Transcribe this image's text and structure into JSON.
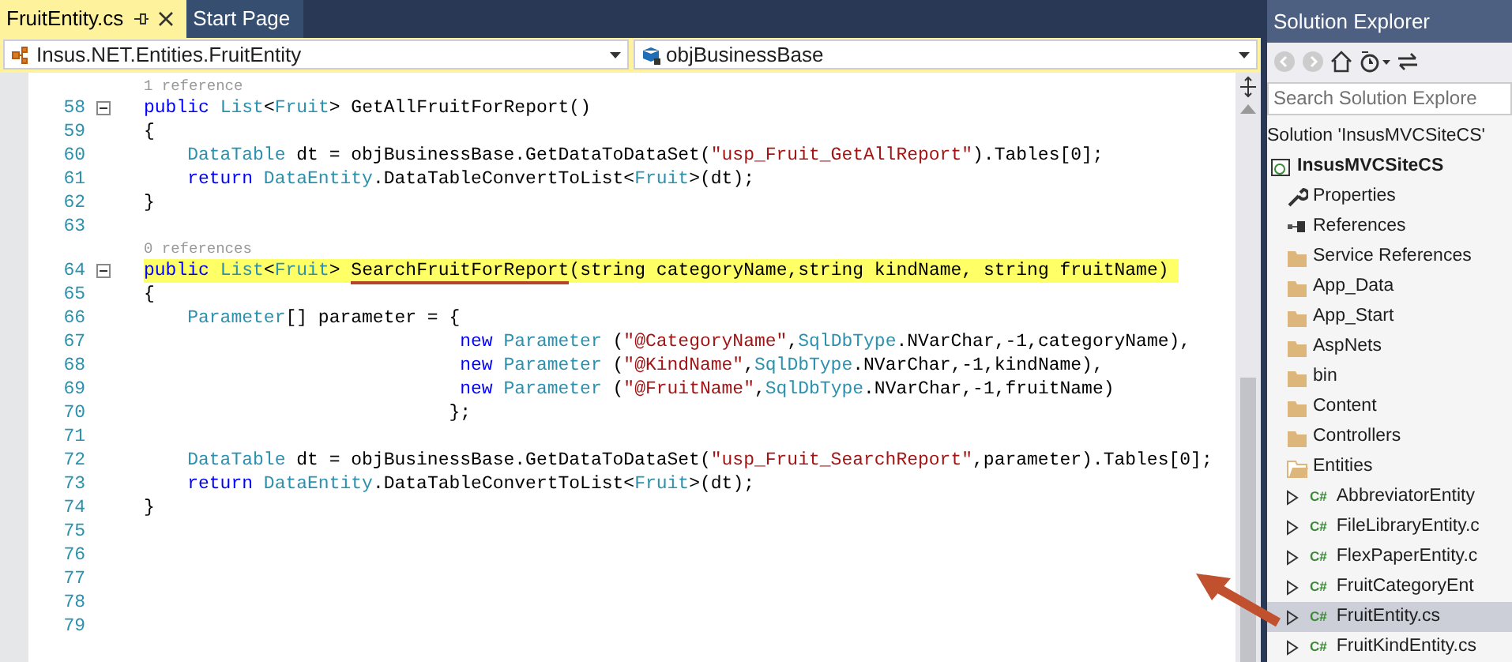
{
  "tabs": [
    {
      "label": "FruitEntity.cs",
      "selected": true,
      "pinnable": true
    },
    {
      "label": "Start Page",
      "selected": false,
      "pinnable": false
    }
  ],
  "navigation": {
    "type_dropdown": "Insus.NET.Entities.FruitEntity",
    "member_dropdown": "objBusinessBase"
  },
  "editor": {
    "lines": [
      {
        "kind": "lens",
        "text": "1 reference"
      },
      {
        "kind": "code",
        "number": "58",
        "fold": true,
        "highlighted": false,
        "tokens": [
          {
            "kind": "keyword",
            "text": "public"
          },
          {
            "kind": "type",
            "text": " List"
          },
          {
            "kind": "plain",
            "text": "<"
          },
          {
            "kind": "type",
            "text": "Fruit"
          },
          {
            "kind": "plain",
            "text": "> GetAllFruitForReport()"
          }
        ]
      },
      {
        "kind": "code",
        "number": "59",
        "fold": false,
        "highlighted": false,
        "tokens": [
          {
            "kind": "plain",
            "text": "{"
          }
        ]
      },
      {
        "kind": "code",
        "number": "60",
        "fold": false,
        "highlighted": false,
        "tokens": [
          {
            "kind": "type",
            "text": "    DataTable"
          },
          {
            "kind": "plain",
            "text": " dt = objBusinessBase.GetDataToDataSet("
          },
          {
            "kind": "string",
            "text": "\"usp_Fruit_GetAllReport\""
          },
          {
            "kind": "plain",
            "text": ").Tables[0];"
          }
        ]
      },
      {
        "kind": "code",
        "number": "61",
        "fold": false,
        "highlighted": false,
        "tokens": [
          {
            "kind": "keyword",
            "text": "    return"
          },
          {
            "kind": "type",
            "text": " DataEntity"
          },
          {
            "kind": "plain",
            "text": ".DataTableConvertToList<"
          },
          {
            "kind": "type",
            "text": "Fruit"
          },
          {
            "kind": "plain",
            "text": ">(dt);"
          }
        ]
      },
      {
        "kind": "code",
        "number": "62",
        "fold": false,
        "highlighted": false,
        "tokens": [
          {
            "kind": "plain",
            "text": "}"
          }
        ]
      },
      {
        "kind": "blank",
        "number": "63"
      },
      {
        "kind": "lens",
        "text": "0 references"
      },
      {
        "kind": "code",
        "number": "64",
        "fold": true,
        "highlighted": true,
        "tokens": [
          {
            "kind": "keyword",
            "text": "public"
          },
          {
            "kind": "type",
            "text": " List"
          },
          {
            "kind": "plain",
            "text": "<"
          },
          {
            "kind": "type",
            "text": "Fruit"
          },
          {
            "kind": "plain",
            "text": "> "
          },
          {
            "kind": "underlined",
            "text": "SearchFruitForReport"
          },
          {
            "kind": "plain",
            "text": "(string categoryName,string kindName, string fruitName)"
          }
        ]
      },
      {
        "kind": "code",
        "number": "65",
        "fold": false,
        "highlighted": false,
        "tokens": [
          {
            "kind": "plain",
            "text": "{"
          }
        ]
      },
      {
        "kind": "code",
        "number": "66",
        "fold": false,
        "highlighted": false,
        "tokens": [
          {
            "kind": "type",
            "text": "    Parameter"
          },
          {
            "kind": "plain",
            "text": "[] parameter = {"
          }
        ]
      },
      {
        "kind": "code",
        "number": "67",
        "fold": false,
        "highlighted": false,
        "tokens": [
          {
            "kind": "keyword",
            "text": "                             new"
          },
          {
            "kind": "type",
            "text": " Parameter"
          },
          {
            "kind": "plain",
            "text": " ("
          },
          {
            "kind": "string",
            "text": "\"@CategoryName\""
          },
          {
            "kind": "plain",
            "text": ","
          },
          {
            "kind": "type",
            "text": "SqlDbType"
          },
          {
            "kind": "plain",
            "text": ".NVarChar,-1,categoryName),"
          }
        ]
      },
      {
        "kind": "code",
        "number": "68",
        "fold": false,
        "highlighted": false,
        "tokens": [
          {
            "kind": "keyword",
            "text": "                             new"
          },
          {
            "kind": "type",
            "text": " Parameter"
          },
          {
            "kind": "plain",
            "text": " ("
          },
          {
            "kind": "string",
            "text": "\"@KindName\""
          },
          {
            "kind": "plain",
            "text": ","
          },
          {
            "kind": "type",
            "text": "SqlDbType"
          },
          {
            "kind": "plain",
            "text": ".NVarChar,-1,kindName),"
          }
        ]
      },
      {
        "kind": "code",
        "number": "69",
        "fold": false,
        "highlighted": false,
        "tokens": [
          {
            "kind": "keyword",
            "text": "                             new"
          },
          {
            "kind": "type",
            "text": " Parameter"
          },
          {
            "kind": "plain",
            "text": " ("
          },
          {
            "kind": "string",
            "text": "\"@FruitName\""
          },
          {
            "kind": "plain",
            "text": ","
          },
          {
            "kind": "type",
            "text": "SqlDbType"
          },
          {
            "kind": "plain",
            "text": ".NVarChar,-1,fruitName)"
          }
        ]
      },
      {
        "kind": "code",
        "number": "70",
        "fold": false,
        "highlighted": false,
        "tokens": [
          {
            "kind": "plain",
            "text": "                            };"
          }
        ]
      },
      {
        "kind": "blank",
        "number": "71"
      },
      {
        "kind": "code",
        "number": "72",
        "fold": false,
        "highlighted": false,
        "tokens": [
          {
            "kind": "type",
            "text": "    DataTable"
          },
          {
            "kind": "plain",
            "text": " dt = objBusinessBase.GetDataToDataSet("
          },
          {
            "kind": "string",
            "text": "\"usp_Fruit_SearchReport\""
          },
          {
            "kind": "plain",
            "text": ",parameter).Tables[0];"
          }
        ]
      },
      {
        "kind": "code",
        "number": "73",
        "fold": false,
        "highlighted": false,
        "tokens": [
          {
            "kind": "keyword",
            "text": "    return"
          },
          {
            "kind": "type",
            "text": " DataEntity"
          },
          {
            "kind": "plain",
            "text": ".DataTableConvertToList<"
          },
          {
            "kind": "type",
            "text": "Fruit"
          },
          {
            "kind": "plain",
            "text": ">(dt);"
          }
        ]
      },
      {
        "kind": "code",
        "number": "74",
        "fold": false,
        "highlighted": false,
        "tokens": [
          {
            "kind": "plain",
            "text": "}"
          }
        ]
      },
      {
        "kind": "blank",
        "number": "75"
      },
      {
        "kind": "blank",
        "number": "76"
      },
      {
        "kind": "blank",
        "number": "77"
      },
      {
        "kind": "blank",
        "number": "78"
      },
      {
        "kind": "blank",
        "number": "79"
      }
    ]
  },
  "solution_explorer": {
    "title": "Solution Explorer",
    "search": {
      "placeholder": "Search Solution Explore"
    },
    "tree": [
      {
        "label": "Solution 'InsusMVCSiteCS'",
        "kind": "solution",
        "selected": false,
        "children": [
          {
            "label": "InsusMVCSiteCS",
            "kind": "project",
            "selected": false,
            "children": [
              {
                "label": "Properties",
                "kind": "properties",
                "selected": false
              },
              {
                "label": "References",
                "kind": "references",
                "selected": false
              },
              {
                "label": "Service References",
                "kind": "folder",
                "selected": false
              },
              {
                "label": "App_Data",
                "kind": "folder",
                "selected": false
              },
              {
                "label": "App_Start",
                "kind": "folder",
                "selected": false
              },
              {
                "label": "AspNets",
                "kind": "folder",
                "selected": false
              },
              {
                "label": "bin",
                "kind": "folder",
                "selected": false
              },
              {
                "label": "Content",
                "kind": "folder",
                "selected": false
              },
              {
                "label": "Controllers",
                "kind": "folder",
                "selected": false
              },
              {
                "label": "Entities",
                "kind": "open-folder",
                "selected": false,
                "children": [
                  {
                    "label": "AbbreviatorEntity",
                    "kind": "csharp",
                    "icon": "C#",
                    "selected": false,
                    "expanded": false
                  },
                  {
                    "label": "FileLibraryEntity.c",
                    "kind": "csharp",
                    "icon": "C#",
                    "selected": false,
                    "expanded": false
                  },
                  {
                    "label": "FlexPaperEntity.c",
                    "kind": "csharp",
                    "icon": "C#",
                    "selected": false,
                    "expanded": false
                  },
                  {
                    "label": "FruitCategoryEnt",
                    "kind": "csharp",
                    "icon": "C#",
                    "selected": false,
                    "expanded": false
                  },
                  {
                    "label": "FruitEntity.cs",
                    "kind": "csharp",
                    "icon": "C#",
                    "selected": true,
                    "expanded": false
                  },
                  {
                    "label": "FruitKindEntity.cs",
                    "kind": "csharp",
                    "icon": "C#",
                    "selected": false,
                    "expanded": false
                  }
                ]
              }
            ]
          }
        ]
      }
    ]
  }
}
